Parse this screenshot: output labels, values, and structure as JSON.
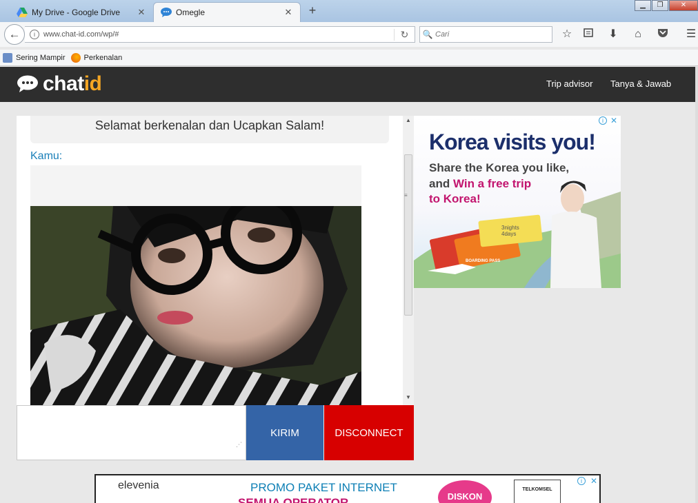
{
  "browser": {
    "tabs": [
      {
        "title": "My Drive - Google Drive",
        "icon": "google-drive-icon",
        "active": false
      },
      {
        "title": "Omegle",
        "icon": "chat-bubble-icon",
        "active": true
      }
    ],
    "new_tab": "+",
    "window_controls": {
      "minimize": "▁",
      "restore": "❐",
      "close": "✕"
    },
    "url": "www.chat-id.com/wp/#",
    "search_placeholder": "Cari",
    "bookmarks": [
      {
        "label": "Sering Mampir",
        "icon": "bookmark-folder-icon"
      },
      {
        "label": "Perkenalan",
        "icon": "firefox-icon"
      }
    ]
  },
  "site": {
    "logo_chat": "chat",
    "logo_id": "id",
    "nav": [
      "Trip advisor",
      "Tanya & Jawab"
    ],
    "accent_color": "#f5a623"
  },
  "chat": {
    "greeting": "Selamat berkenalan dan Ucapkan Salam!",
    "you_label": "Kamu:",
    "send_label": "KIRIM",
    "disconnect_label": "DISCONNECT",
    "send_color": "#3464a7",
    "disconnect_color": "#d70000"
  },
  "ad_right": {
    "title": "Korea visits you!",
    "line1": "Share the Korea you like,",
    "line2_prefix": "and ",
    "line2_highlight": "Win a free trip",
    "line3": "to Korea!",
    "ticket_nights": "3nights",
    "ticket_days": "4days",
    "boarding_pass": "BOARDING PASS"
  },
  "ad_bottom": {
    "brand": "elevenia",
    "headline": "PROMO PAKET INTERNET",
    "subline": "SEMUA OPERATOR",
    "badge": "DISKON",
    "partner": "TELKOMSEL"
  }
}
